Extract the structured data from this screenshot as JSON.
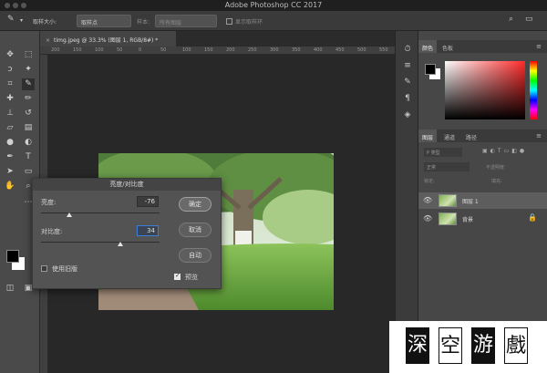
{
  "window": {
    "title": "Adobe Photoshop CC 2017"
  },
  "options_bar": {
    "sample_size_label": "取样大小:",
    "sample_size_value": "取样点",
    "sample_label": "样本:",
    "sample_value": "所有图层",
    "show_ring_label": "显示取样环"
  },
  "document": {
    "tab_title": "timg.jpeg @ 33.3% (图层 1, RGB/8#) *"
  },
  "ruler_ticks": [
    "200",
    "150",
    "100",
    "50",
    "0",
    "50",
    "100",
    "150",
    "200",
    "250",
    "300",
    "350",
    "400",
    "450",
    "500",
    "550"
  ],
  "dialog": {
    "title": "亮度/对比度",
    "brightness_label": "亮度:",
    "brightness_value": "-76",
    "brightness_fraction": 0.24,
    "contrast_label": "对比度:",
    "contrast_value": "34",
    "contrast_fraction": 0.67,
    "ok_label": "确定",
    "cancel_label": "取消",
    "auto_label": "自动",
    "legacy_label": "使用旧版",
    "legacy_checked": false,
    "preview_label": "预览",
    "preview_checked": true
  },
  "color_panel": {
    "tabs": [
      "颜色",
      "色板"
    ],
    "accent": "#ff2a2a"
  },
  "layers_panel": {
    "tabs": [
      "图层",
      "通道",
      "路径"
    ],
    "filter_placeholder": "P 类型",
    "blend_mode": "正常",
    "opacity_label": "不透明度:",
    "lock_label": "锁定:",
    "fill_label": "填充:",
    "layers": [
      {
        "name": "图层 1",
        "selected": true,
        "locked": false
      },
      {
        "name": "背景",
        "selected": false,
        "locked": true
      }
    ]
  },
  "watermark": {
    "text": [
      "深",
      "空",
      "游",
      "戲"
    ]
  }
}
